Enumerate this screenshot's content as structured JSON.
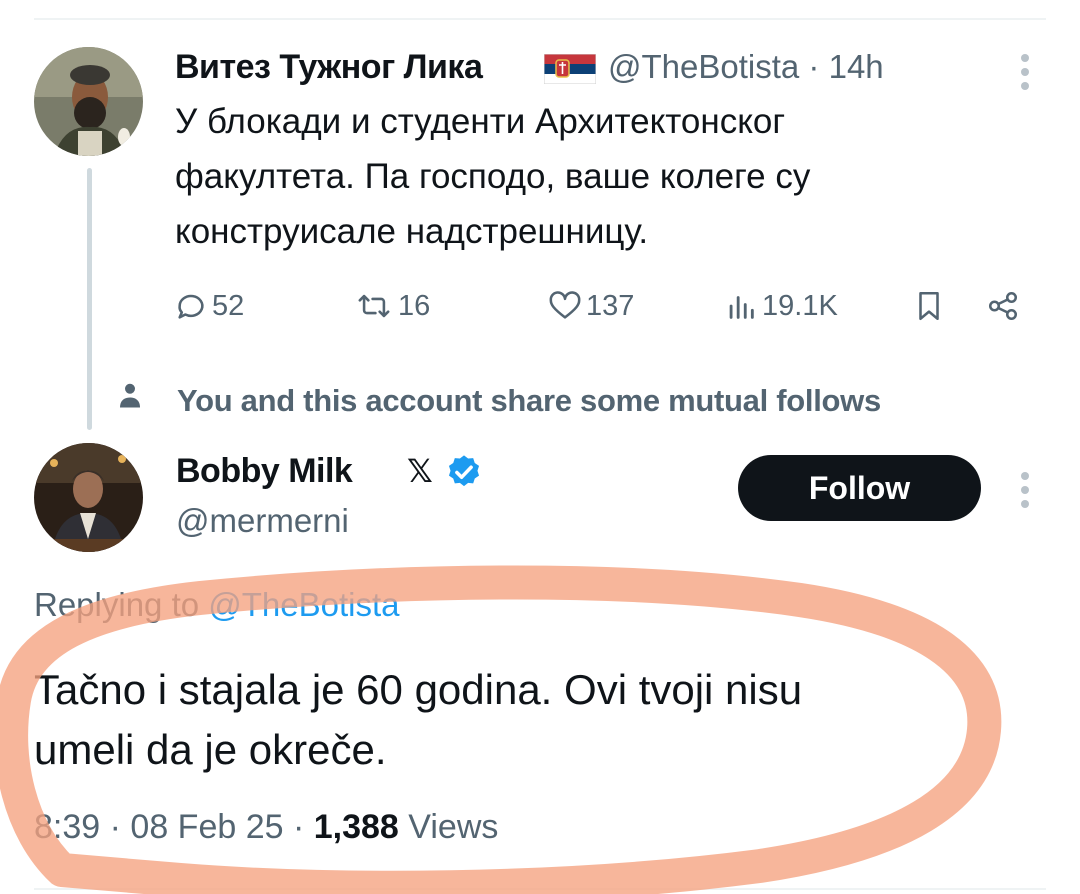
{
  "original_tweet": {
    "display_name": "Витез Тужног Лика",
    "flag": "serbia-flag",
    "handle": "@TheBotista",
    "separator": "·",
    "age": "14h",
    "text_lines": [
      "У блокади и студенти Архитектонског",
      "факултета. Па господо, ваше колеге су",
      "конструисале надстрешницу."
    ],
    "stats": {
      "replies": "52",
      "reposts": "16",
      "likes": "137",
      "views": "19.1K"
    }
  },
  "social_context": {
    "text": "You and this account share some mutual follows"
  },
  "reply_author": {
    "display_name": "Bobby Milk",
    "x_badge": "𝕏",
    "handle": "@mermerni",
    "follow_label": "Follow"
  },
  "reply": {
    "replying_prefix": "Replying to ",
    "replying_handle": "@TheBotista",
    "text_lines": [
      "Tačno i stajala je 60 godina. Ovi tvoji nisu",
      "umeli da je okreče."
    ],
    "time": "8:39",
    "sep1": " · ",
    "date": "08 Feb 25",
    "sep2": " · ",
    "views_count": "1,388",
    "views_label": " Views"
  },
  "colors": {
    "accent": "#1d9bf0",
    "annotation": "#f5a17f",
    "muted": "#536471"
  }
}
